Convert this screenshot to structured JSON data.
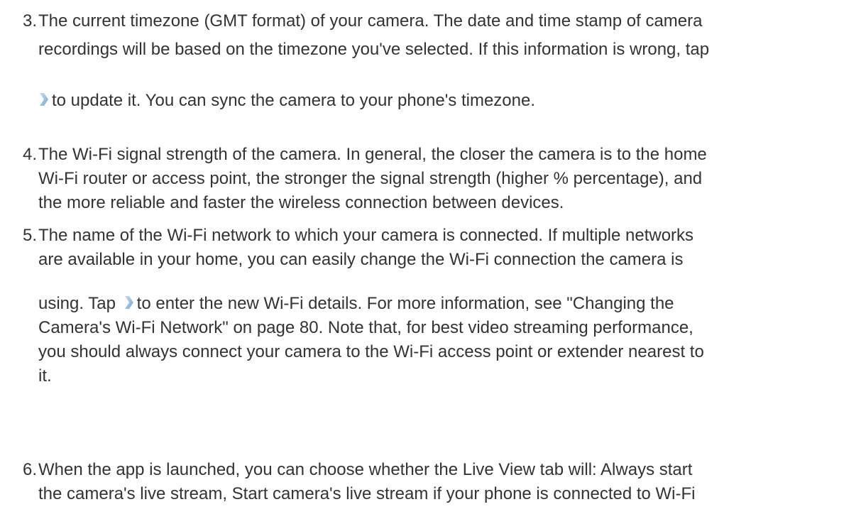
{
  "items": [
    {
      "number": "3.",
      "lines": [
        "The current timezone (GMT format) of your camera. The date and time stamp of camera",
        "recordings will be based on the timezone you've selected. If this information is wrong, tap",
        "to update it. You can sync the camera to your phone's timezone."
      ]
    },
    {
      "number": "4.",
      "lines": [
        "The Wi-Fi signal strength of the camera. In general, the closer the camera is to the home",
        "Wi-Fi router or access point, the stronger the signal strength (higher % percentage), and",
        "the more reliable and faster the wireless connection between devices."
      ]
    },
    {
      "number": "5.",
      "lines": [
        "The name of the Wi-Fi network to which your camera is connected. If multiple networks",
        "are available in your home, you can easily change the Wi-Fi connection the camera is",
        "using. Tap",
        "to enter the new Wi-Fi details. For more information, see \"Changing the",
        "Camera's Wi-Fi Network\" on page 80. Note that, for best video streaming performance,",
        "you should always connect your camera to the Wi-Fi access point or extender nearest to",
        "it."
      ]
    },
    {
      "number": "6.",
      "lines": [
        "When the app is launched, you can choose whether the Live View tab will: Always start",
        "the camera's live stream, Start camera's live stream if your phone is connected to Wi-Fi"
      ]
    }
  ],
  "icons": {
    "inline_arrow": "chevron-right-icon",
    "arrow_color": "#8fb8e0"
  }
}
